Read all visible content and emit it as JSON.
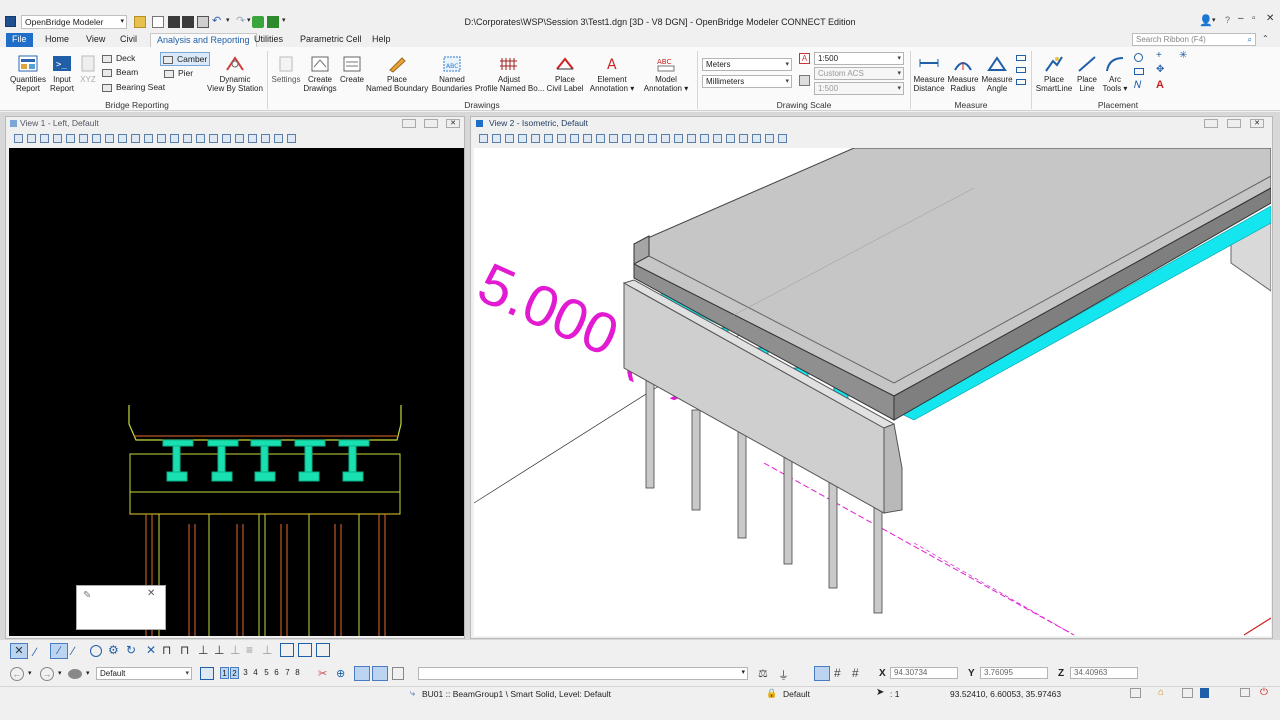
{
  "app": {
    "name": "OpenBridge Modeler",
    "title": "D:\\Corporates\\WSP\\Session 3\\Test1.dgn [3D - V8 DGN] - OpenBridge Modeler CONNECT Edition",
    "search_placeholder": "Search Ribbon (F4)"
  },
  "tabs": [
    "File",
    "Home",
    "View",
    "Civil",
    "Analysis and Reporting",
    "Utilities",
    "Parametric Cell",
    "Help"
  ],
  "active_tab": "Analysis and Reporting",
  "ribbon": {
    "bridge_reporting": {
      "label": "Bridge Reporting",
      "quantities": "Quantities\nReport",
      "input": "Input\nReport",
      "xyz": "XYZ",
      "deck": "Deck",
      "beam": "Beam",
      "bearing_seat": "Bearing Seat",
      "camber": "Camber",
      "pier": "Pier",
      "dynamic_view": "Dynamic\nView By Station"
    },
    "drawings": {
      "label": "Drawings",
      "settings": "Settings",
      "create_drawings": "Create\nDrawings",
      "create": "Create",
      "place_named_boundary": "Place\nNamed Boundary",
      "named_boundaries": "Named\nBoundaries",
      "adjust_profile": "Adjust\nProfile Named Bo...",
      "place_civil_label": "Place\nCivil Label",
      "element_annotation": "Element\nAnnotation ▾",
      "model_annotation": "Model\nAnnotation ▾"
    },
    "drawing_scale": {
      "label": "Drawing Scale",
      "units1": "Meters",
      "units2": "Millimeters",
      "scale1": "1:500",
      "acs": "Custom ACS",
      "scale2": "1:500"
    },
    "measure": {
      "label": "Measure",
      "distance": "Measure\nDistance",
      "radius": "Measure\nRadius",
      "angle": "Measure\nAngle"
    },
    "placement": {
      "label": "Placement",
      "smartline": "Place\nSmartLine",
      "line": "Place\nLine",
      "arc": "Arc\nTools ▾"
    }
  },
  "views": {
    "view1": "View 1 - Left, Default",
    "view2": "View 2 - Isometric, Default",
    "station_text": "5.000 (B)"
  },
  "bottom": {
    "level_default": "Default",
    "view_numbers": [
      "1",
      "2",
      "3",
      "4",
      "5",
      "6",
      "7",
      "8"
    ],
    "x_label": "X",
    "x_value": "94.30734",
    "y_label": "Y",
    "y_value": "3.76095",
    "z_label": "Z",
    "z_value": "34.40963",
    "status_msg": "BU01 :: BeamGroup1 \\ Smart Solid, Level: Default",
    "active_level": "Default",
    "scale": ": 1",
    "coords": "93.52410, 6.60053, 35.97463"
  },
  "colors": {
    "accent": "#1f6ec7",
    "girder": "#19e0b0",
    "magenta": "#e21ad2",
    "beam_cyan": "#14e6f0"
  }
}
